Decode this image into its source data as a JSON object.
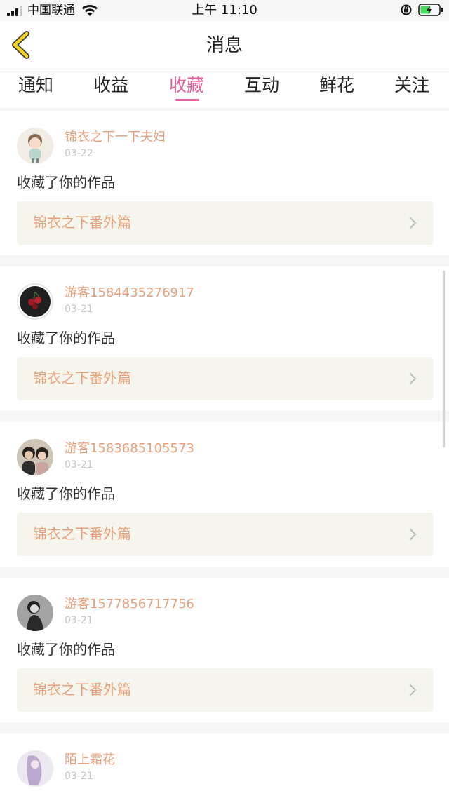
{
  "status_bar": {
    "carrier": "中国联通",
    "time": "上午 11:10"
  },
  "nav": {
    "title": "消息",
    "back_icon": "chevron-left-icon"
  },
  "tabs": [
    {
      "label": "通知",
      "active": false
    },
    {
      "label": "收益",
      "active": false
    },
    {
      "label": "收藏",
      "active": true
    },
    {
      "label": "互动",
      "active": false
    },
    {
      "label": "鲜花",
      "active": false
    },
    {
      "label": "关注",
      "active": false
    }
  ],
  "colors": {
    "accent": "#e05f9a",
    "name": "#e8a07a",
    "work_box_bg": "#f5f5ee"
  },
  "items": [
    {
      "user": "锦衣之下一下夫妇",
      "date": "03-22",
      "action": "收藏了你的作品",
      "work": "锦衣之下番外篇"
    },
    {
      "user": "游客1584435276917",
      "date": "03-21",
      "action": "收藏了你的作品",
      "work": "锦衣之下番外篇"
    },
    {
      "user": "游客1583685105573",
      "date": "03-21",
      "action": "收藏了你的作品",
      "work": "锦衣之下番外篇"
    },
    {
      "user": "游客1577856717756",
      "date": "03-21",
      "action": "收藏了你的作品",
      "work": "锦衣之下番外篇"
    },
    {
      "user": "陌上霜花",
      "date": "03-21"
    }
  ]
}
